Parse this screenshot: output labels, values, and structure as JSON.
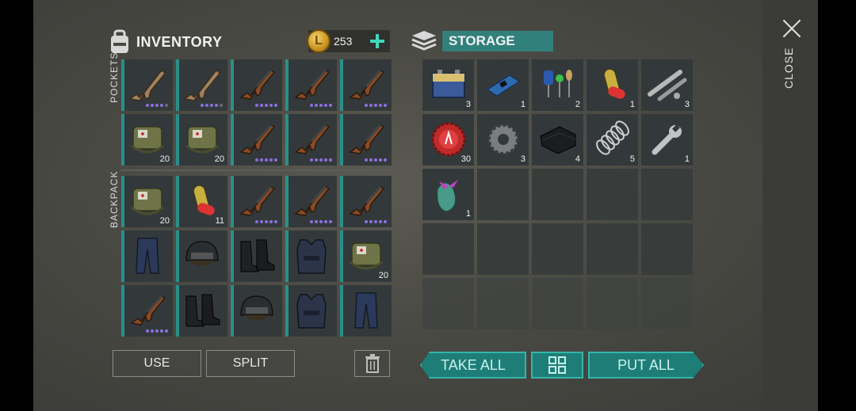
{
  "inventory": {
    "title": "INVENTORY",
    "coins": "253",
    "coin_symbol": "L"
  },
  "storage": {
    "title": "STORAGE"
  },
  "labels": {
    "pockets": "POCKETS",
    "backpack": "BACKPACK",
    "close": "CLOSE"
  },
  "buttons": {
    "use": "USE",
    "split": "SPLIT",
    "take_all": "TAKE ALL",
    "put_all": "PUT ALL"
  },
  "pockets": [
    {
      "item": "rifle-tan",
      "dots": 4
    },
    {
      "item": "rifle-tan",
      "dots": 4
    },
    {
      "item": "ak-rifle",
      "dots": 5
    },
    {
      "item": "ak-rifle",
      "dots": 5
    },
    {
      "item": "ak-rifle",
      "dots": 5
    },
    {
      "item": "medkit-bag",
      "count": "20"
    },
    {
      "item": "medkit-bag",
      "count": "20"
    },
    {
      "item": "ak-rifle",
      "dots": 5
    },
    {
      "item": "ak-rifle",
      "dots": 5
    },
    {
      "item": "ak-rifle",
      "dots": 5
    }
  ],
  "backpack": [
    {
      "item": "medkit-bag",
      "count": "20"
    },
    {
      "item": "pill",
      "count": "11"
    },
    {
      "item": "ak-rifle",
      "dots": 5
    },
    {
      "item": "ak-rifle",
      "dots": 5
    },
    {
      "item": "ak-rifle",
      "dots": 5
    },
    {
      "item": "pants"
    },
    {
      "item": "helmet"
    },
    {
      "item": "boots"
    },
    {
      "item": "vest"
    },
    {
      "item": "medkit-bag",
      "count": "20"
    },
    {
      "item": "ak-rifle",
      "dots": 5
    },
    {
      "item": "boots"
    },
    {
      "item": "helmet"
    },
    {
      "item": "vest"
    },
    {
      "item": "pants"
    }
  ],
  "storage_items": [
    {
      "item": "battery",
      "count": "3"
    },
    {
      "item": "circuit-board",
      "count": "1"
    },
    {
      "item": "electronic-parts",
      "count": "2"
    },
    {
      "item": "pill",
      "count": "1"
    },
    {
      "item": "pipes",
      "count": "3"
    },
    {
      "item": "bottle-cap",
      "count": "30"
    },
    {
      "item": "gear",
      "count": "3"
    },
    {
      "item": "cloth",
      "count": "4"
    },
    {
      "item": "spring",
      "count": "5"
    },
    {
      "item": "wrench",
      "count": "1"
    },
    {
      "item": "gift-ornament",
      "count": "1"
    }
  ]
}
